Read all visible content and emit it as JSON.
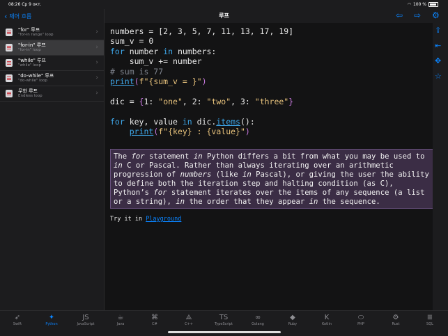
{
  "status": {
    "time": "08:26",
    "date": "Ср 9 окт.",
    "battery": "100 %"
  },
  "sidebar": {
    "back_label": "제어 흐름",
    "items": [
      {
        "title": "\"for\" 루프",
        "subtitle": "\"for-in range\" loop"
      },
      {
        "title": "\"for-in\" 루프",
        "subtitle": "\"for-in\" loop"
      },
      {
        "title": "\"while\" 루프",
        "subtitle": "\"while\" loop"
      },
      {
        "title": "\"do-while\" 루프",
        "subtitle": "\"do-while\" loop"
      },
      {
        "title": "무한 루프",
        "subtitle": "Endless loop"
      }
    ]
  },
  "header": {
    "title": "루프"
  },
  "code": {
    "l1a": "numbers = [2, 3, 5, 7, 11, 13, 17, 19]",
    "l2": "sum_v = 0",
    "l3_kw1": "for",
    "l3_var": " number ",
    "l3_kw2": "in",
    "l3_rest": " numbers:",
    "l4": "    sum_v += number",
    "l5": "# sum is 77",
    "l6_fn": "print",
    "l6_p1": "(",
    "l6_str": "f\"{sum_v = }\"",
    "l6_p2": ")",
    "l7a": "dic = ",
    "l7b": "{",
    "l7c": "1: ",
    "l7d": "\"one\"",
    "l7e": ", 2: ",
    "l7f": "\"two\"",
    "l7g": ", 3: ",
    "l7h": "\"three\"",
    "l7i": "}",
    "l8_kw1": "for",
    "l8_var": " key, value ",
    "l8_kw2": "in",
    "l8_obj": " dic.",
    "l8_fn": "items",
    "l8_end": "():",
    "l9_pad": "    ",
    "l9_fn": "print",
    "l9_p1": "(",
    "l9_str": "f\"{key} : {value}\"",
    "l9_p2": ")"
  },
  "prose": {
    "p1": "The ",
    "e1": "for",
    "p2": " statement ",
    "e2": "in",
    "p3": " Python differs a bit from what you may be used to ",
    "e3": "in",
    "p4": " C or Pascal. Rather than always iterating over an arithmetic progression of ",
    "e4": "numbers",
    "p5": " (like ",
    "e5": "in",
    "p6": " Pascal), or giving the user the ability to define both the iteration step and halting condition (as C), Python’s ",
    "e6": "for",
    "p7": " statement iterates over the items of any sequence (a list or a string), ",
    "e7": "in",
    "p8": " the order that they appear ",
    "e8": "in",
    "p9": " the sequence."
  },
  "try": {
    "prefix": "Try it in ",
    "link": "Playground"
  },
  "tabs": [
    {
      "label": "Swift",
      "icon": "swift-icon",
      "glyph": "➶"
    },
    {
      "label": "Python",
      "icon": "python-icon",
      "glyph": "✦"
    },
    {
      "label": "JavaScript",
      "icon": "javascript-icon",
      "glyph": "JS"
    },
    {
      "label": "Java",
      "icon": "java-icon",
      "glyph": "☕"
    },
    {
      "label": "C#",
      "icon": "csharp-icon",
      "glyph": "⌘"
    },
    {
      "label": "C++",
      "icon": "cpp-icon",
      "glyph": "⟁"
    },
    {
      "label": "TypeScript",
      "icon": "typescript-icon",
      "glyph": "TS"
    },
    {
      "label": "Golang",
      "icon": "golang-icon",
      "glyph": "∞"
    },
    {
      "label": "Ruby",
      "icon": "ruby-icon",
      "glyph": "◆"
    },
    {
      "label": "Kotlin",
      "icon": "kotlin-icon",
      "glyph": "K"
    },
    {
      "label": "PHP",
      "icon": "php-icon",
      "glyph": "⬭"
    },
    {
      "label": "Rust",
      "icon": "rust-icon",
      "glyph": "⚙"
    },
    {
      "label": "SQL",
      "icon": "sql-icon",
      "glyph": "≣"
    }
  ],
  "active_tab": "Python",
  "colors": {
    "accent": "#0a84ff",
    "background": "#1c1c1e",
    "prose_bg": "#3b2d45"
  }
}
